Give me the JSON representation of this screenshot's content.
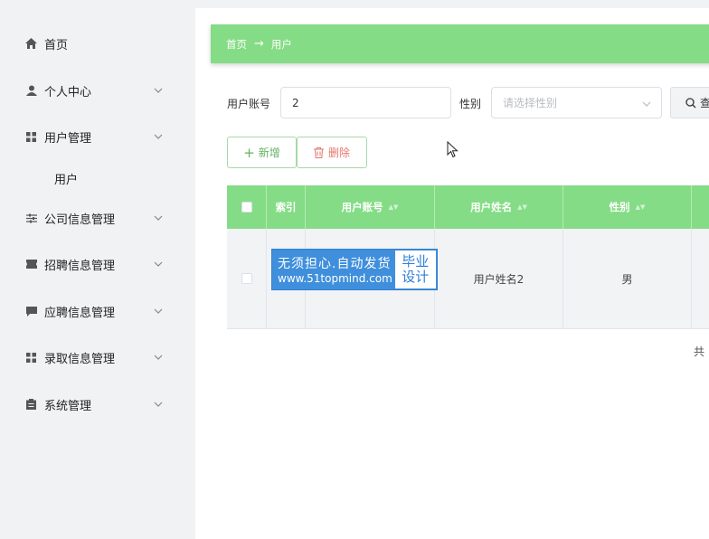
{
  "sidebar": {
    "items": [
      {
        "label": "首页",
        "icon": "home-icon"
      },
      {
        "label": "个人中心",
        "icon": "user-icon"
      },
      {
        "label": "用户管理",
        "icon": "grid-icon"
      },
      {
        "label": "公司信息管理",
        "icon": "sliders-icon"
      },
      {
        "label": "招聘信息管理",
        "icon": "ticket-icon"
      },
      {
        "label": "应聘信息管理",
        "icon": "message-icon"
      },
      {
        "label": "录取信息管理",
        "icon": "grid-icon"
      },
      {
        "label": "系统管理",
        "icon": "clipboard-icon"
      }
    ],
    "sub_item": "用户"
  },
  "breadcrumb": {
    "home": "首页",
    "separator": "→",
    "current": "用户"
  },
  "search": {
    "account_label": "用户账号",
    "account_value": "2",
    "gender_label": "性别",
    "gender_placeholder": "请选择性别",
    "search_button": "查"
  },
  "actions": {
    "add": "新增",
    "delete": "删除"
  },
  "table": {
    "headers": [
      "索引",
      "用户账号",
      "用户姓名",
      "性别"
    ],
    "rows": [
      {
        "name": "用户姓名2",
        "gender": "男"
      }
    ]
  },
  "watermark": {
    "line1": "无须担心.自动发货",
    "line2": "www.51topmind.com",
    "badge1": "毕业",
    "badge2": "设计"
  },
  "footer": {
    "text": "共"
  },
  "colors": {
    "accent": "#85dc86",
    "danger": "#e6766c"
  }
}
